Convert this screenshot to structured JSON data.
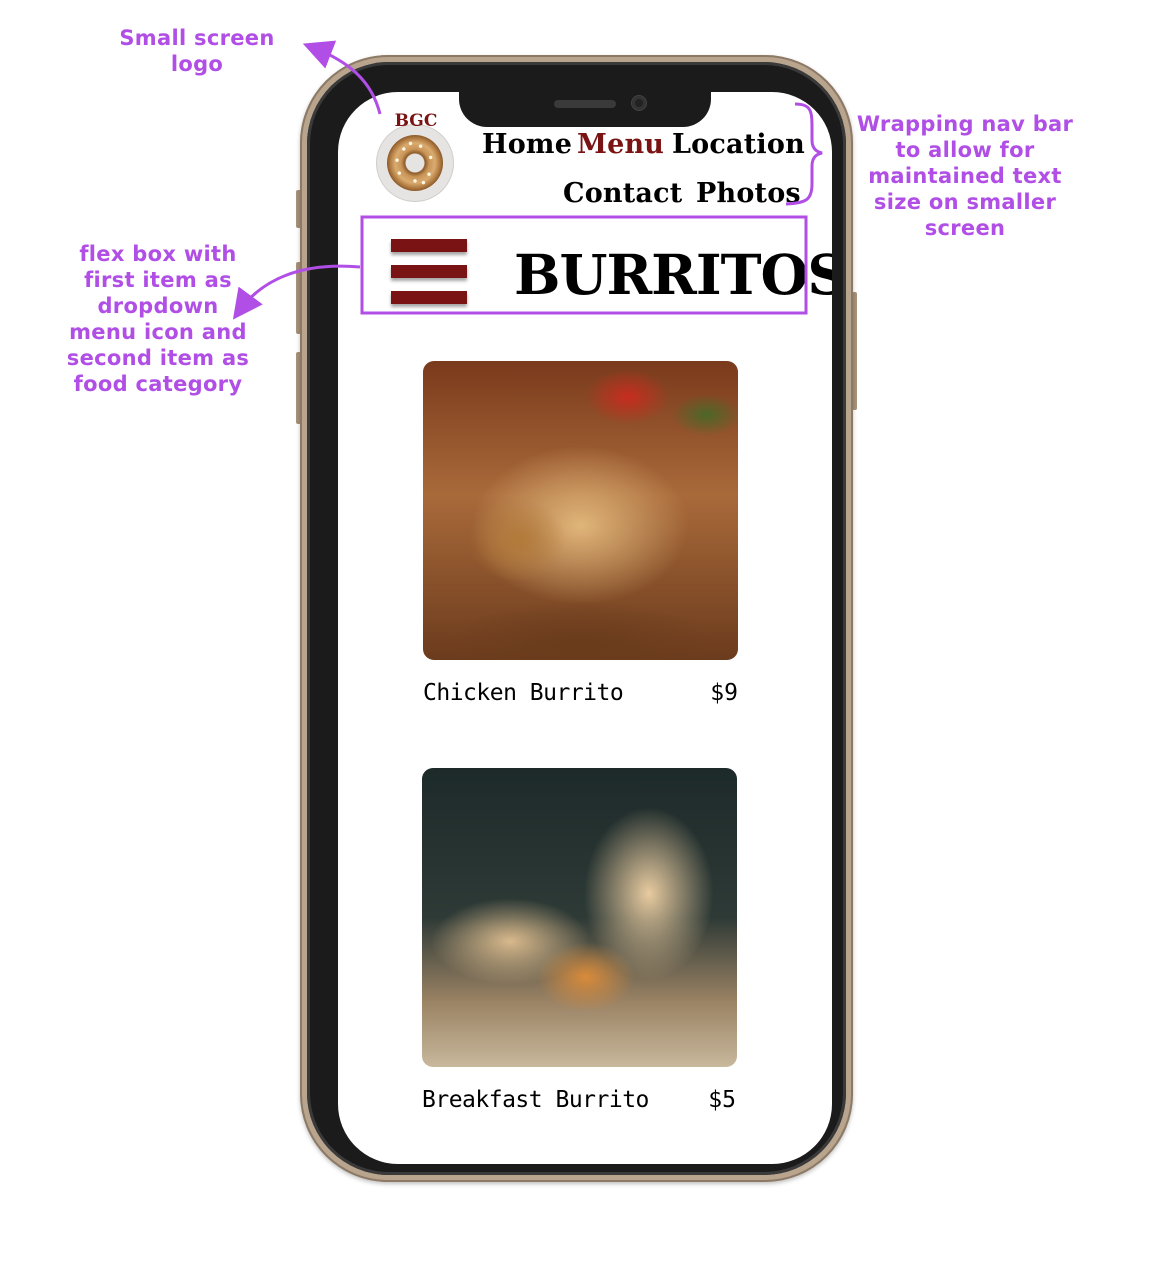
{
  "annotations": {
    "logo": "Small screen logo",
    "nav": "Wrapping nav bar to allow for maintained text size on smaller screen",
    "flex": "flex box with first item as dropdown menu icon and second item as food category"
  },
  "logo": {
    "text": "BGC",
    "icon": "bagel-icon"
  },
  "nav": {
    "items": [
      {
        "label": "Home"
      },
      {
        "label": "Menu",
        "active": true
      },
      {
        "label": "Location"
      },
      {
        "label": "Contact"
      },
      {
        "label": "Photos"
      }
    ]
  },
  "category": {
    "title": "BURRITOS",
    "menu_icon": "hamburger-menu-icon"
  },
  "items": [
    {
      "name": "Chicken Burrito",
      "price": "$9"
    },
    {
      "name": "Breakfast Burrito",
      "price": "$5"
    }
  ],
  "colors": {
    "annotation": "#b04ee6",
    "brand": "#7a1313",
    "text": "#000000"
  }
}
